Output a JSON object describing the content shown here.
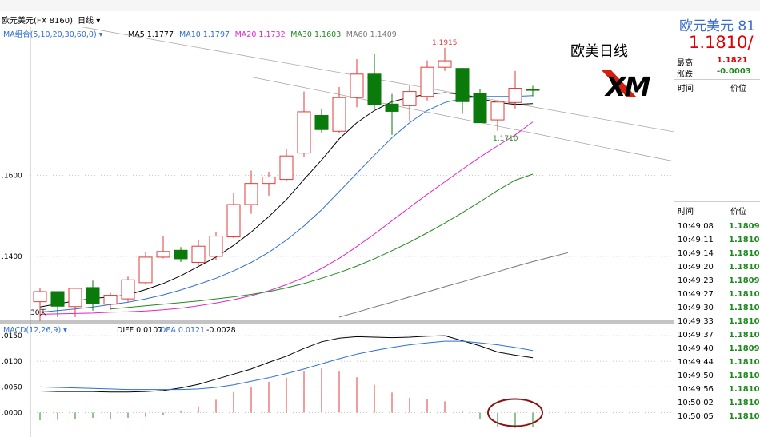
{
  "title_bar": {
    "symbol": "欧元美元(FX 8160)",
    "period": "日线",
    "indicator": "MA组合(5,10,20,30,60,0)",
    "ma_labels": [
      {
        "text": "MA5 1.1777",
        "color": "#000000"
      },
      {
        "text": "MA10 1.1797",
        "color": "#2e6fd6"
      },
      {
        "text": "MA20 1.1732",
        "color": "#e026c8"
      },
      {
        "text": "MA30 1.1603",
        "color": "#1f8a1f"
      },
      {
        "text": "MA60 1.1409",
        "color": "#777777"
      }
    ]
  },
  "overlay": {
    "heading": "欧美日线",
    "logo_text": "XM",
    "high_label": "1.1915",
    "low_label": "1.1710",
    "days_label": "30天"
  },
  "macd": {
    "header": "MACD(12,26,9)",
    "diff": "DIFF 0.0107",
    "dea": "DEA 0.0121",
    "macd_value": "-0.0028"
  },
  "right_panel": {
    "title": "欧元美元 81",
    "price": "1.1810/",
    "high_label": "最高",
    "high_value": "1.1821",
    "change_label": "涨跌",
    "change_value": "-0.0003",
    "col_time": "时间",
    "col_price": "价位",
    "ticks": [
      {
        "time": "10:49:08",
        "price": "1.1809"
      },
      {
        "time": "10:49:11",
        "price": "1.1810"
      },
      {
        "time": "10:49:14",
        "price": "1.1810"
      },
      {
        "time": "10:49:20",
        "price": "1.1810"
      },
      {
        "time": "10:49:23",
        "price": "1.1809"
      },
      {
        "time": "10:49:27",
        "price": "1.1810"
      },
      {
        "time": "10:49:30",
        "price": "1.1810"
      },
      {
        "time": "10:49:33",
        "price": "1.1810"
      },
      {
        "time": "10:49:37",
        "price": "1.1810"
      },
      {
        "time": "10:49:40",
        "price": "1.1809"
      },
      {
        "time": "10:49:44",
        "price": "1.1810"
      },
      {
        "time": "10:49:50",
        "price": "1.1810"
      },
      {
        "time": "10:49:56",
        "price": "1.1810"
      },
      {
        "time": "10:50:02",
        "price": "1.1810"
      },
      {
        "time": "10:50:05",
        "price": "1.1810"
      }
    ]
  },
  "chart_data": [
    {
      "type": "candlestick",
      "y_ticks": [
        ".1600",
        ".1400"
      ],
      "ylim": [
        1.124,
        1.1966
      ],
      "candles": [
        {
          "o": 1.1288,
          "h": 1.1321,
          "l": 1.1241,
          "c": 1.1313
        },
        {
          "o": 1.1313,
          "h": 1.1314,
          "l": 1.125,
          "c": 1.1277
        },
        {
          "o": 1.1276,
          "h": 1.1312,
          "l": 1.125,
          "c": 1.1321
        },
        {
          "o": 1.1323,
          "h": 1.134,
          "l": 1.1266,
          "c": 1.1283
        },
        {
          "o": 1.1282,
          "h": 1.131,
          "l": 1.1268,
          "c": 1.1304
        },
        {
          "o": 1.1295,
          "h": 1.135,
          "l": 1.1288,
          "c": 1.1342
        },
        {
          "o": 1.1335,
          "h": 1.141,
          "l": 1.133,
          "c": 1.1398
        },
        {
          "o": 1.1398,
          "h": 1.145,
          "l": 1.1395,
          "c": 1.1412
        },
        {
          "o": 1.1415,
          "h": 1.1423,
          "l": 1.1386,
          "c": 1.1394
        },
        {
          "o": 1.1385,
          "h": 1.1441,
          "l": 1.1378,
          "c": 1.1425
        },
        {
          "o": 1.14,
          "h": 1.1461,
          "l": 1.1392,
          "c": 1.145
        },
        {
          "o": 1.1448,
          "h": 1.1557,
          "l": 1.1445,
          "c": 1.1528
        },
        {
          "o": 1.1528,
          "h": 1.1612,
          "l": 1.1505,
          "c": 1.158
        },
        {
          "o": 1.158,
          "h": 1.1609,
          "l": 1.155,
          "c": 1.1596
        },
        {
          "o": 1.159,
          "h": 1.1665,
          "l": 1.1585,
          "c": 1.1648
        },
        {
          "o": 1.1655,
          "h": 1.1807,
          "l": 1.1645,
          "c": 1.1757
        },
        {
          "o": 1.1748,
          "h": 1.1765,
          "l": 1.1705,
          "c": 1.1713
        },
        {
          "o": 1.1709,
          "h": 1.1818,
          "l": 1.1705,
          "c": 1.1792
        },
        {
          "o": 1.1792,
          "h": 1.1887,
          "l": 1.1768,
          "c": 1.185
        },
        {
          "o": 1.185,
          "h": 1.1899,
          "l": 1.1763,
          "c": 1.1775
        },
        {
          "o": 1.1776,
          "h": 1.1801,
          "l": 1.17,
          "c": 1.1758
        },
        {
          "o": 1.1772,
          "h": 1.1822,
          "l": 1.1733,
          "c": 1.1807
        },
        {
          "o": 1.1795,
          "h": 1.1884,
          "l": 1.1785,
          "c": 1.1867
        },
        {
          "o": 1.1867,
          "h": 1.1915,
          "l": 1.1858,
          "c": 1.1883
        },
        {
          "o": 1.1864,
          "h": 1.1866,
          "l": 1.1752,
          "c": 1.1782
        },
        {
          "o": 1.1802,
          "h": 1.1814,
          "l": 1.173,
          "c": 1.173
        },
        {
          "o": 1.1737,
          "h": 1.1784,
          "l": 1.171,
          "c": 1.1781
        },
        {
          "o": 1.178,
          "h": 1.1858,
          "l": 1.1765,
          "c": 1.1815
        },
        {
          "o": 1.1812,
          "h": 1.1821,
          "l": 1.1795,
          "c": 1.181
        }
      ],
      "ma_series": [
        {
          "name": "MA5",
          "color": "#000000",
          "start": 0,
          "values": [
            1.1275,
            1.1283,
            1.129,
            1.1296,
            1.13,
            1.1305,
            1.1318,
            1.1333,
            1.1352,
            1.1375,
            1.1398,
            1.1427,
            1.146,
            1.1498,
            1.154,
            1.159,
            1.1638,
            1.169,
            1.173,
            1.176,
            1.1782,
            1.1793,
            1.18,
            1.1804,
            1.18,
            1.179,
            1.178,
            1.1775,
            1.1777
          ]
        },
        {
          "name": "MA10",
          "color": "#2e6fd6",
          "start": 0,
          "values": [
            1.1262,
            1.1266,
            1.127,
            1.1275,
            1.1281,
            1.1287,
            1.1295,
            1.1305,
            1.1317,
            1.1331,
            1.1346,
            1.1364,
            1.1385,
            1.141,
            1.144,
            1.1475,
            1.1515,
            1.156,
            1.1605,
            1.165,
            1.1693,
            1.173,
            1.176,
            1.178,
            1.179,
            1.1795,
            1.1795,
            1.1795,
            1.1797
          ]
        },
        {
          "name": "MA20",
          "color": "#e026c8",
          "start": 0,
          "values": [
            1.1257,
            1.1258,
            1.1259,
            1.126,
            1.1262,
            1.1263,
            1.1265,
            1.1268,
            1.1272,
            1.1278,
            1.1285,
            1.1293,
            1.1303,
            1.1315,
            1.133,
            1.1348,
            1.137,
            1.1395,
            1.1424,
            1.1455,
            1.1488,
            1.1521,
            1.1553,
            1.1584,
            1.1615,
            1.1645,
            1.1673,
            1.17,
            1.1732
          ]
        },
        {
          "name": "MA30",
          "color": "#1f8a1f",
          "start": 4,
          "values": [
            1.127,
            1.1274,
            1.1278,
            1.1282,
            1.1286,
            1.129,
            1.1295,
            1.13,
            1.1306,
            1.1313,
            1.1322,
            1.1333,
            1.1346,
            1.136,
            1.1376,
            1.1394,
            1.1414,
            1.1435,
            1.1458,
            1.1482,
            1.1508,
            1.1535,
            1.1563,
            1.1588,
            1.1603
          ]
        },
        {
          "name": "MA60",
          "color": "#777777",
          "start": 17,
          "values": [
            1.125,
            1.1262,
            1.1275,
            1.1287,
            1.13,
            1.1312,
            1.1325,
            1.1337,
            1.135,
            1.1362,
            1.1375,
            1.1387,
            1.1398,
            1.1409
          ]
        }
      ],
      "trendlines": [
        {
          "x1": 0,
          "y1": 1.1985,
          "x2": 43.5,
          "y2": 1.165
        },
        {
          "x1": 12,
          "y1": 1.1843,
          "x2": 43.5,
          "y2": 1.157
        }
      ]
    },
    {
      "type": "macd",
      "y_ticks": [
        ".0150",
        ".0100",
        ".0050",
        ".0000"
      ],
      "ylim": [
        -0.0035,
        0.0175
      ],
      "diff": [
        0.0042,
        0.0041,
        0.0041,
        0.0041,
        0.004,
        0.004,
        0.0041,
        0.0043,
        0.0048,
        0.0055,
        0.0065,
        0.0075,
        0.0085,
        0.0098,
        0.011,
        0.0125,
        0.0138,
        0.0145,
        0.0148,
        0.0147,
        0.0146,
        0.0147,
        0.0149,
        0.015,
        0.014,
        0.013,
        0.0118,
        0.0112,
        0.0107
      ],
      "dea": [
        0.005,
        0.0049,
        0.0048,
        0.0047,
        0.0046,
        0.0045,
        0.0045,
        0.0045,
        0.0045,
        0.0046,
        0.0049,
        0.0054,
        0.0061,
        0.0068,
        0.0076,
        0.0085,
        0.0095,
        0.0105,
        0.0114,
        0.0121,
        0.0127,
        0.0132,
        0.0136,
        0.0139,
        0.0139,
        0.0136,
        0.0132,
        0.0127,
        0.0121
      ],
      "histogram": [
        -0.0015,
        -0.0014,
        -0.0012,
        -0.001,
        -0.0012,
        -0.001,
        -0.0008,
        -0.0004,
        0.0004,
        0.0012,
        0.0025,
        0.004,
        0.005,
        0.006,
        0.0068,
        0.008,
        0.0086,
        0.008,
        0.0069,
        0.0054,
        0.0039,
        0.0029,
        0.0026,
        0.0022,
        0.0002,
        -0.0012,
        -0.0028,
        -0.003,
        -0.0028
      ]
    }
  ]
}
